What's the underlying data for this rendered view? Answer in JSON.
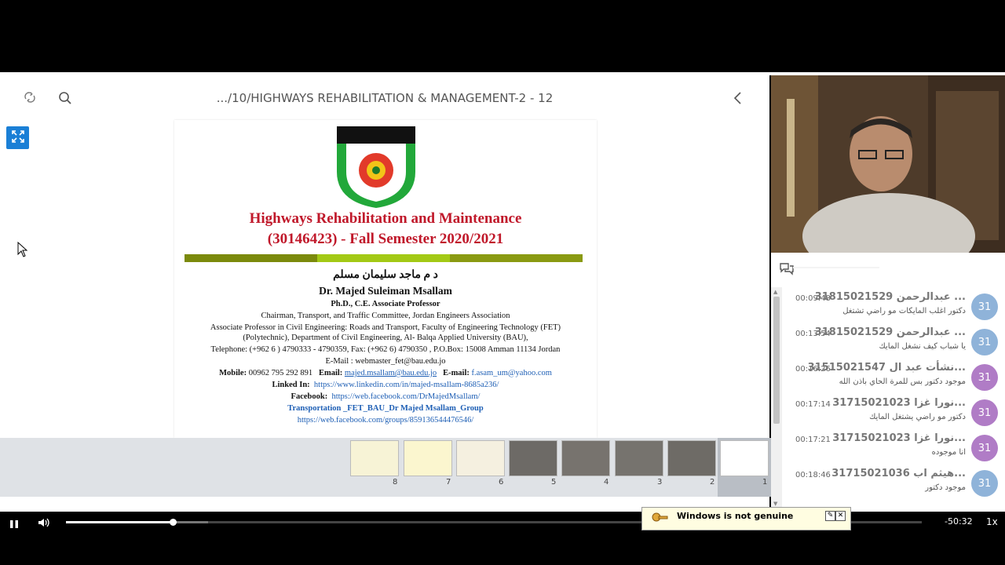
{
  "toolbar": {
    "title": ".../10/HIGHWAYS REHABILITATION & MANAGEMENT-2 - 12"
  },
  "icons": {
    "sync": "sync-icon",
    "search": "search-icon",
    "back": "chevron-left-icon",
    "expand": "expand-icon",
    "chat": "chat-icon",
    "pause": "pause-icon",
    "volume": "volume-icon"
  },
  "slide": {
    "title_line1": "Highways Rehabilitation and Maintenance",
    "title_line2": "(30146423) - Fall Semester 2020/2021",
    "arabic_name": "د م ماجد سليمان مسلم",
    "name": "Dr. Majed Suleiman Msallam",
    "degree": "Ph.D., C.E. Associate Professor",
    "chairman": "Chairman, Transport, and Traffic Committee, Jordan Engineers Association",
    "assoc1": "Associate Professor in Civil Engineering: Roads and Transport, Faculty of Engineering Technology (FET)",
    "assoc2": "(Polytechnic), Department of Civil Engineering, Al- Balqa Applied University (BAU),",
    "telephone": "Telephone: (+962 6 ) 4790333 - 4790359,  Fax: (+962 6) 4790350 ,  P.O.Box: 15008 Amman 11134 Jordan",
    "email_line": "E-Mail : webmaster_fet@bau.edu.jo",
    "mobile_label": "Mobile:",
    "mobile": "00962 795 292 891",
    "email_label": "Email:",
    "email1": "majed.msallam@bau.edu.jo",
    "email2_label": "E-mail:",
    "email2": "f.asam_um@yahoo.com",
    "linkedin_label": "Linked In:",
    "linkedin": "https://www.linkedin.com/in/majed-msallam-8685a236/",
    "facebook_label": "Facebook:",
    "facebook": "https://web.facebook.com/DrMajedMsallam/",
    "group_name": "Transportation _FET_BAU_Dr Majed Msallam_Group",
    "group_link": "https://web.facebook.com/groups/859136544476546/"
  },
  "thumbnails": [
    {
      "num": "8"
    },
    {
      "num": "7"
    },
    {
      "num": "6"
    },
    {
      "num": "5"
    },
    {
      "num": "4"
    },
    {
      "num": "3"
    },
    {
      "num": "2"
    },
    {
      "num": "1"
    }
  ],
  "chat": {
    "messages": [
      {
        "time": "00:09:48",
        "name": "31815021529 عبدالرحمن ...",
        "text": "دكتور اغلب المايكات مو راضي تشتغل",
        "avatar": "31",
        "color": "#8fb3d9"
      },
      {
        "time": "00:13:54",
        "name": "31815021529 عبدالرحمن ...",
        "text": "يا شباب كيف نشغل المايك",
        "avatar": "31",
        "color": "#8fb3d9"
      },
      {
        "time": "00:16:26",
        "name": "31515021547 نشأت عبد ال...",
        "text": "موجود دكتور بس للمرة الحاي باذن الله",
        "avatar": "31",
        "color": "#b07cc6"
      },
      {
        "time": "00:17:14",
        "name": "31715021023 نورا غزا...",
        "text": "دكتور مو راضي يشتغل المايك",
        "avatar": "31",
        "color": "#b07cc6"
      },
      {
        "time": "00:17:21",
        "name": "31715021023 نورا غزا...",
        "text": "انا موجوده",
        "avatar": "31",
        "color": "#b07cc6"
      },
      {
        "time": "00:18:46",
        "name": "31715021036 هيثم اب...",
        "text": "موجود دكتور",
        "avatar": "31",
        "color": "#8fb3d9"
      }
    ]
  },
  "player": {
    "remaining": "-50:32",
    "speed": "1x",
    "progress": 0.125
  },
  "notice": {
    "title": "Windows is not genuine"
  }
}
